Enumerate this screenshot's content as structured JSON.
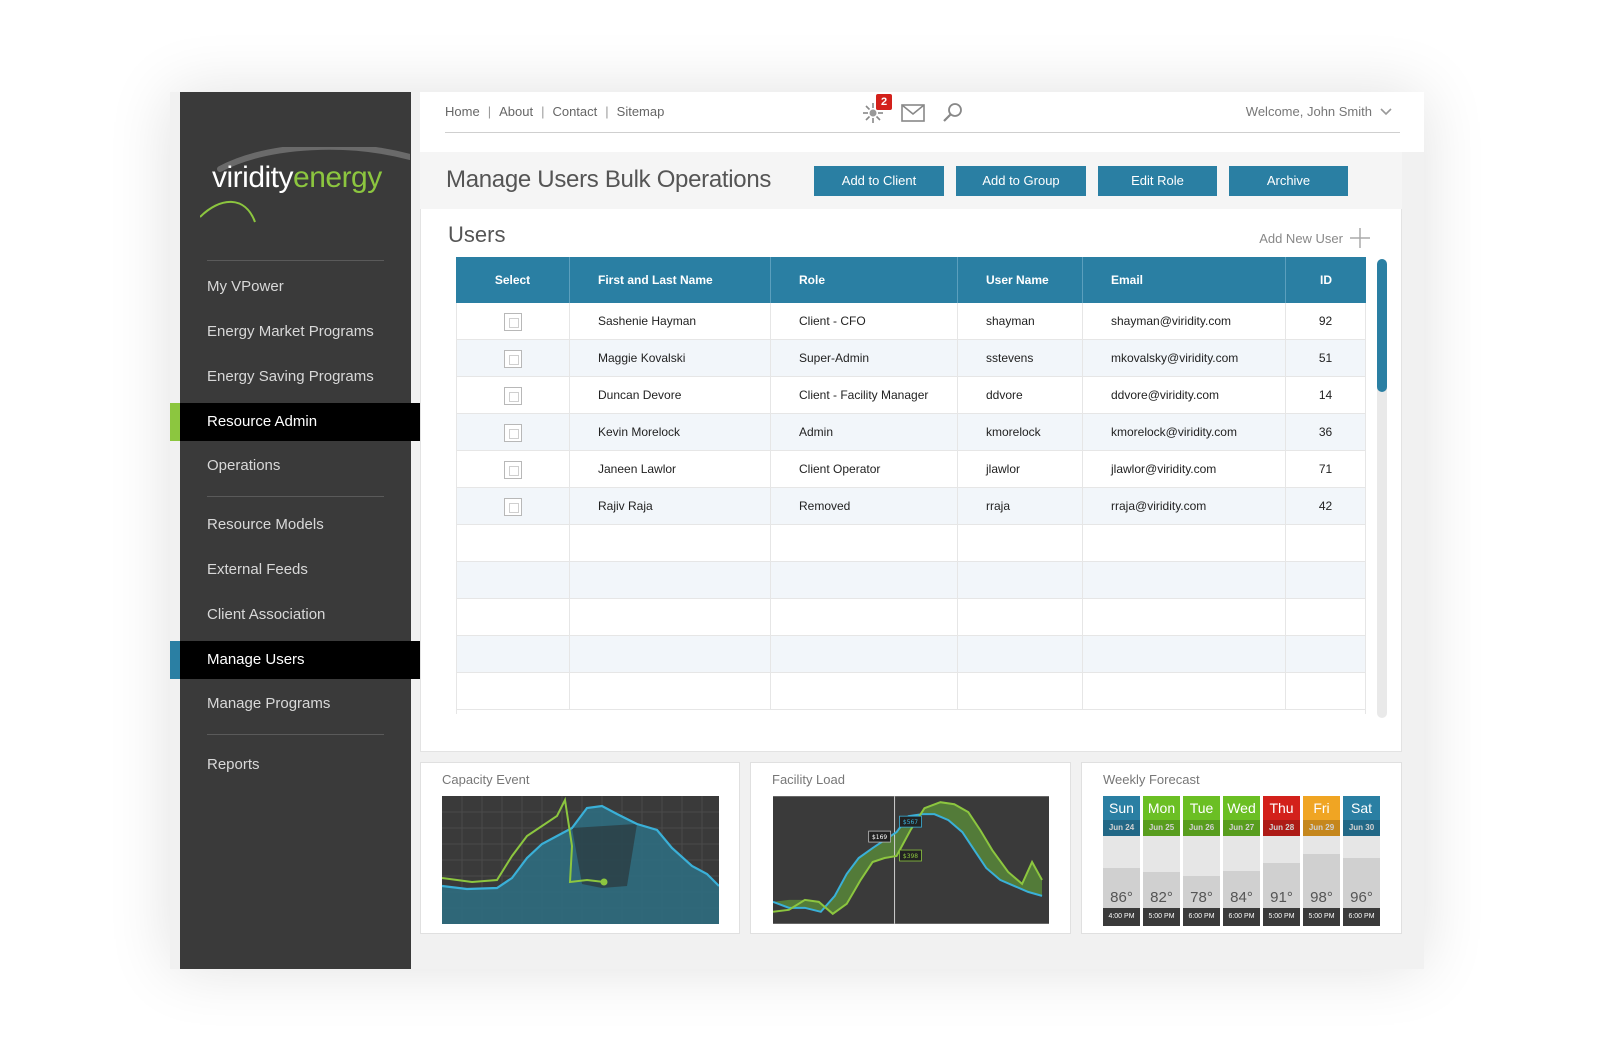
{
  "brand": {
    "name_a": "viridity",
    "name_b": "energy"
  },
  "nav": {
    "items": [
      {
        "label": "My VPower"
      },
      {
        "label": "Energy Market Programs"
      },
      {
        "label": "Energy Saving Programs"
      },
      {
        "label": "Resource Admin"
      },
      {
        "label": "Operations"
      },
      {
        "label": "Resource Models"
      },
      {
        "label": "External Feeds"
      },
      {
        "label": "Client Association"
      },
      {
        "label": "Manage Users"
      },
      {
        "label": "Manage Programs"
      },
      {
        "label": "Reports"
      }
    ],
    "accent_green": "#8cc63f",
    "accent_blue": "#2a7fa3"
  },
  "topbar": {
    "links": [
      "Home",
      "About",
      "Contact",
      "Sitemap"
    ],
    "notification_count": "2",
    "welcome": "Welcome, John Smith"
  },
  "header": {
    "title": "Manage Users Bulk Operations",
    "buttons": [
      "Add to Client",
      "Add to Group",
      "Edit Role",
      "Archive"
    ]
  },
  "users": {
    "title": "Users",
    "add_label": "Add New User",
    "columns": [
      "Select",
      "First and Last Name",
      "Role",
      "User Name",
      "Email",
      "ID"
    ],
    "rows": [
      {
        "name": "Sashenie Hayman",
        "role": "Client - CFO",
        "username": "shayman",
        "email": "shayman@viridity.com",
        "id": "92"
      },
      {
        "name": "Maggie Kovalski",
        "role": "Super-Admin",
        "username": "sstevens",
        "email": "mkovalsky@viridity.com",
        "id": "51"
      },
      {
        "name": "Duncan Devore",
        "role": "Client - Facility Manager",
        "username": "ddvore",
        "email": "ddvore@viridity.com",
        "id": "14"
      },
      {
        "name": "Kevin Morelock",
        "role": "Admin",
        "username": "kmorelock",
        "email": "kmorelock@viridity.com",
        "id": "36"
      },
      {
        "name": "Janeen Lawlor",
        "role": "Client Operator",
        "username": "jlawlor",
        "email": "jlawlor@viridity.com",
        "id": "71"
      },
      {
        "name": "Rajiv Raja",
        "role": "Removed",
        "username": "rraja",
        "email": "rraja@viridity.com",
        "id": "42"
      }
    ]
  },
  "widgets": {
    "capacity": {
      "title": "Capacity Event"
    },
    "facility": {
      "title": "Facility Load",
      "labels": [
        "$169",
        "$567",
        "$398"
      ]
    },
    "forecast": {
      "title": "Weekly Forecast",
      "days": [
        {
          "day": "Sun",
          "date": "Jun 24",
          "temp": "86°",
          "time": "4:00 PM",
          "color": "#2a7fa3",
          "level": 0.55
        },
        {
          "day": "Mon",
          "date": "Jun 25",
          "temp": "82°",
          "time": "5:00 PM",
          "color": "#6bbf24",
          "level": 0.5
        },
        {
          "day": "Tue",
          "date": "Jun 26",
          "temp": "78°",
          "time": "6:00 PM",
          "color": "#6bbf24",
          "level": 0.45
        },
        {
          "day": "Wed",
          "date": "Jun 27",
          "temp": "84°",
          "time": "6:00 PM",
          "color": "#6bbf24",
          "level": 0.52
        },
        {
          "day": "Thu",
          "date": "Jun 28",
          "temp": "91°",
          "time": "5:00 PM",
          "color": "#d3211b",
          "level": 0.62
        },
        {
          "day": "Fri",
          "date": "Jun 29",
          "temp": "98°",
          "time": "5:00 PM",
          "color": "#f0a523",
          "level": 0.75
        },
        {
          "day": "Sat",
          "date": "Jun 30",
          "temp": "96°",
          "time": "6:00 PM",
          "color": "#2a7fa3",
          "level": 0.7
        }
      ]
    }
  }
}
